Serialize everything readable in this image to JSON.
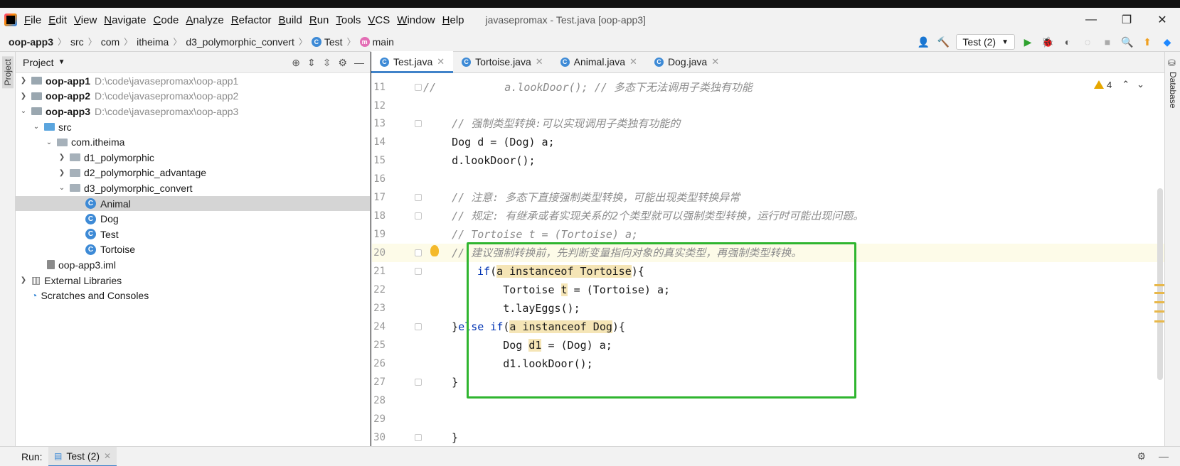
{
  "window": {
    "title": "javasepromax - Test.java [oop-app3]",
    "menu": [
      "File",
      "Edit",
      "View",
      "Navigate",
      "Code",
      "Analyze",
      "Refactor",
      "Build",
      "Run",
      "Tools",
      "VCS",
      "Window",
      "Help"
    ],
    "controls": {
      "minimize": "—",
      "restore": "❐",
      "close": "✕"
    }
  },
  "breadcrumb": [
    "oop-app3",
    "src",
    "com",
    "itheima",
    "d3_polymorphic_convert",
    "Test",
    "main"
  ],
  "toolbar": {
    "run_config": "Test (2)"
  },
  "side_tabs": {
    "left": "Project",
    "right": "Database"
  },
  "project": {
    "header": "Project",
    "tree": [
      {
        "label": "oop-app1",
        "path": "D:\\code\\javasepromax\\oop-app1"
      },
      {
        "label": "oop-app2",
        "path": "D:\\code\\javasepromax\\oop-app2"
      },
      {
        "label": "oop-app3",
        "path": "D:\\code\\javasepromax\\oop-app3"
      },
      {
        "label": "src"
      },
      {
        "label": "com.itheima"
      },
      {
        "label": "d1_polymorphic"
      },
      {
        "label": "d2_polymorphic_advantage"
      },
      {
        "label": "d3_polymorphic_convert"
      },
      {
        "label": "Animal"
      },
      {
        "label": "Dog"
      },
      {
        "label": "Test"
      },
      {
        "label": "Tortoise"
      },
      {
        "label": "oop-app3.iml"
      },
      {
        "label": "External Libraries"
      },
      {
        "label": "Scratches and Consoles"
      }
    ]
  },
  "editor": {
    "tabs": [
      "Test.java",
      "Tortoise.java",
      "Animal.java",
      "Dog.java"
    ],
    "warnings": "4",
    "line_numbers": [
      "11",
      "12",
      "13",
      "14",
      "15",
      "16",
      "17",
      "18",
      "19",
      "20",
      "21",
      "22",
      "23",
      "24",
      "25",
      "26",
      "27",
      "28",
      "29",
      "30"
    ],
    "lines": {
      "l11a": "//",
      "l11b": "        a.lookDoor(); // 多态下无法调用子类独有功能",
      "l13": "    // 强制类型转换:可以实现调用子类独有功能的",
      "l14": "    Dog d = (Dog) a;",
      "l15": "    d.lookDoor();",
      "l17": "    // 注意: 多态下直接强制类型转换，可能出现类型转换异常",
      "l18": "    // 规定: 有继承或者实现关系的2个类型就可以强制类型转换，运行时可能出现问题。",
      "l19": "    // Tortoise t = (Tortoise) a;",
      "l20": "    // 建议强制转换前，先判断变量指向对象的真实类型，再强制类型转换。",
      "l21_kw": "if",
      "l21_a": "(",
      "l21_hl": "a instanceof Tortoise",
      "l21_b": "){",
      "l22_a": "        Tortoise ",
      "l22_hl": "t",
      "l22_b": " = (Tortoise) a;",
      "l23": "        t.layEggs();",
      "l24_a": "    }",
      "l24_kw": "else if",
      "l24_b": "(",
      "l24_hl": "a instanceof Dog",
      "l24_c": "){",
      "l25_a": "        Dog ",
      "l25_hl": "d1",
      "l25_b": " = (Dog) a;",
      "l26": "        d1.lookDoor();",
      "l27": "    }",
      "l30": "}"
    }
  },
  "bottom": {
    "run_label": "Run:",
    "run_tab": "Test (2)"
  }
}
